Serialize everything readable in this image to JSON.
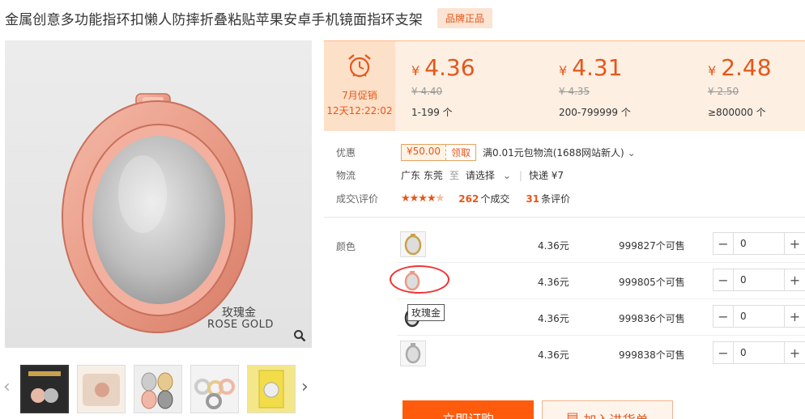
{
  "product": {
    "title": "金属创意多功能指环扣懒人防摔折叠粘贴苹果安卓手机镜面指环支架",
    "badge": "品牌正品"
  },
  "image": {
    "label_cn": "玫瑰金",
    "label_en": "ROSE GOLD",
    "zoom_icon": "magnifier-icon"
  },
  "thumbnails": {
    "prev_icon": "chevron-left-icon",
    "next_icon": "chevron-right-icon",
    "items": [
      "thumb-1",
      "thumb-2",
      "thumb-3",
      "thumb-4",
      "thumb-5"
    ]
  },
  "promo": {
    "icon": "alarm-clock-icon",
    "title": "7月促销",
    "countdown": "12天12:22:02"
  },
  "price_tiers": [
    {
      "currency": "¥",
      "price": "4.36",
      "old_price": "¥ 4.40",
      "range": "1-199 个"
    },
    {
      "currency": "¥",
      "price": "4.31",
      "old_price": "¥ 4.35",
      "range": "200-799999 个"
    },
    {
      "currency": "¥",
      "price": "2.48",
      "old_price": "¥ 2.50",
      "range": "≥800000 个"
    }
  ],
  "info": {
    "discount_label": "优惠",
    "coupon_amount": "¥50.00",
    "coupon_action": "领取",
    "shipping_promo": "满0.01元包物流(1688网站新人)",
    "logistics_label": "物流",
    "origin": "广东 东莞",
    "to_word": "至",
    "select_dest": "请选择",
    "express": "快递 ¥7",
    "deal_label": "成交\\评价",
    "orders_count": "262",
    "orders_unit": "个成交",
    "reviews_count": "31",
    "reviews_unit": "条评价",
    "rating_stars": 4.5
  },
  "sku": {
    "label": "颜色",
    "tooltip": "玫瑰金",
    "rows": [
      {
        "price": "4.36元",
        "stock": "999827个可售",
        "qty": "0"
      },
      {
        "price": "4.36元",
        "stock": "999805个可售",
        "qty": "0"
      },
      {
        "price": "4.36元",
        "stock": "999836个可售",
        "qty": "0"
      },
      {
        "price": "4.36元",
        "stock": "999838个可售",
        "qty": "0"
      }
    ]
  },
  "actions": {
    "buy_now": "立即订购",
    "add_to_cart": "加入进货单"
  },
  "colors": {
    "accent": "#e4571b",
    "button_orange": "#ff5b0c",
    "panel_bg": "#fdefe2"
  }
}
